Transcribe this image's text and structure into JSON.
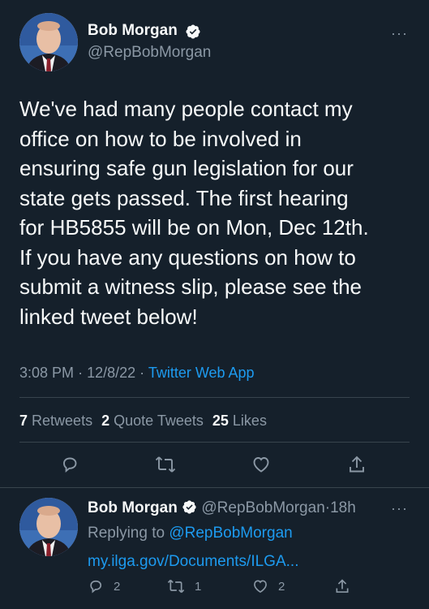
{
  "tweet": {
    "author_name": "Bob Morgan",
    "author_handle": "@RepBobMorgan",
    "more_label": "···",
    "text": "We've had many people contact my\noffice on how to be involved in\nensuring safe gun legislation for our\nstate gets passed. The first hearing\nfor HB5855 will be on Mon, Dec 12th.\nIf you have any questions on how to\nsubmit a witness slip, please see the\nlinked tweet below!",
    "time": "3:08 PM",
    "date": "12/8/22",
    "separator": "·",
    "source": "Twitter Web App",
    "stats": {
      "retweets_count": "7",
      "retweets_label": "Retweets",
      "quotes_count": "2",
      "quotes_label": "Quote Tweets",
      "likes_count": "25",
      "likes_label": "Likes"
    }
  },
  "reply": {
    "author_name": "Bob Morgan",
    "author_handle": "@RepBobMorgan",
    "separator": "·",
    "age": "18h",
    "more_label": "···",
    "replying_prefix": "Replying to",
    "replying_to": "@RepBobMorgan",
    "link_text": "my.ilga.gov/Documents/ILGA...",
    "reply_count": "2",
    "retweet_count": "1",
    "like_count": "2"
  },
  "colors": {
    "background": "#15202b",
    "text": "#f7f9f9",
    "muted": "#8b98a5",
    "link": "#1d9bf0",
    "divider": "#38444d"
  },
  "icons": [
    "verified-badge-icon",
    "reply-icon",
    "retweet-icon",
    "like-icon",
    "share-icon",
    "more-icon"
  ]
}
